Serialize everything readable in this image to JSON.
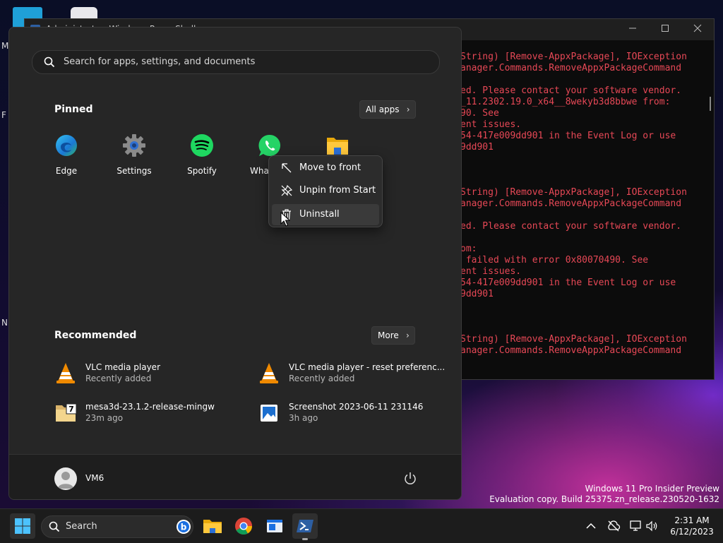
{
  "terminal": {
    "title": "Administrator: Windows PowerShell",
    "lines": [
      "String) [Remove-AppxPackage], IOException",
      "anager.Commands.RemoveAppxPackageCommand",
      "",
      "ed. Please contact your software vendor.",
      "_11.2302.19.0_x64__8wekyb3d8bbwe from:",
      "90. See",
      "ent issues.",
      "54-417e009dd901 in the Event Log or use",
      "9dd901",
      "",
      "",
      "",
      "String) [Remove-AppxPackage], IOException",
      "anager.Commands.RemoveAppxPackageCommand",
      "",
      "ed. Please contact your software vendor.",
      "",
      "om:",
      " failed with error 0x80070490. See",
      "ent issues.",
      "54-417e009dd901 in the Event Log or use",
      "9dd901",
      "",
      "",
      "",
      "String) [Remove-AppxPackage], IOException",
      "anager.Commands.RemoveAppxPackageCommand"
    ]
  },
  "desktop": {
    "side_letters": [
      "M",
      "F",
      "N"
    ]
  },
  "start_menu": {
    "search_placeholder": "Search for apps, settings, and documents",
    "pinned_title": "Pinned",
    "all_apps_label": "All apps",
    "pinned": [
      {
        "label": "Edge",
        "icon": "edge-icon"
      },
      {
        "label": "Settings",
        "icon": "settings-gear-icon"
      },
      {
        "label": "Spotify",
        "icon": "spotify-icon"
      },
      {
        "label": "WhatsApp",
        "icon": "whatsapp-icon"
      },
      {
        "label": "File Explorer",
        "icon": "folder-icon"
      }
    ],
    "recommended_title": "Recommended",
    "more_label": "More",
    "recommended": [
      {
        "name": "VLC media player",
        "sub": "Recently added",
        "icon": "vlc-icon"
      },
      {
        "name": "VLC media player - reset preferenc...",
        "sub": "Recently added",
        "icon": "vlc-icon"
      },
      {
        "name": "mesa3d-23.1.2-release-mingw",
        "sub": "23m ago",
        "icon": "7zip-archive-icon"
      },
      {
        "name": "Screenshot 2023-06-11 231146",
        "sub": "3h ago",
        "icon": "image-file-icon"
      }
    ],
    "user": "VM6"
  },
  "context_menu": {
    "items": [
      {
        "label": "Move to front",
        "icon": "arrow-up-left-icon"
      },
      {
        "label": "Unpin from Start",
        "icon": "unpin-icon"
      },
      {
        "label": "Uninstall",
        "icon": "trash-icon"
      }
    ]
  },
  "watermark": {
    "line1": "Windows 11 Pro Insider Preview",
    "line2": "Evaluation copy. Build 25375.zn_release.230520-1632"
  },
  "taskbar": {
    "search_label": "Search",
    "time": "2:31 AM",
    "date": "6/12/2023"
  },
  "colors": {
    "error_text": "#e74856",
    "start_bg": "#262626",
    "accent": "#0078d4"
  }
}
